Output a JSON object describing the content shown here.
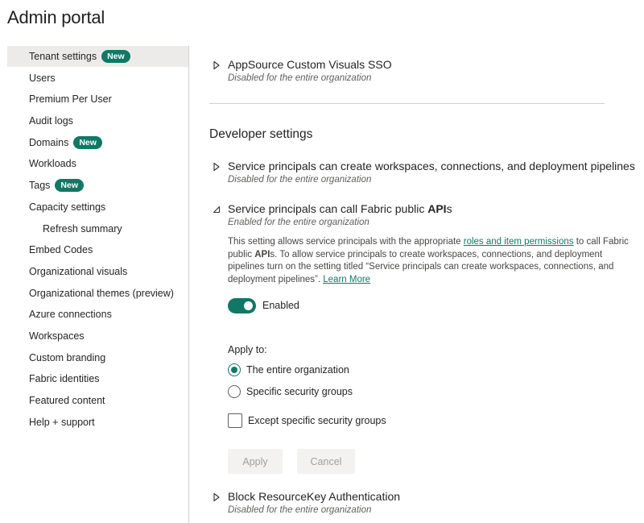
{
  "page": {
    "title": "Admin portal"
  },
  "sidebar": {
    "items": [
      {
        "label": "Tenant settings",
        "badge": "New",
        "active": true
      },
      {
        "label": "Users"
      },
      {
        "label": "Premium Per User"
      },
      {
        "label": "Audit logs"
      },
      {
        "label": "Domains",
        "badge": "New"
      },
      {
        "label": "Workloads"
      },
      {
        "label": "Tags",
        "badge": "New"
      },
      {
        "label": "Capacity settings"
      },
      {
        "label": "Refresh summary",
        "sub": true
      },
      {
        "label": "Embed Codes"
      },
      {
        "label": "Organizational visuals"
      },
      {
        "label": "Organizational themes (preview)"
      },
      {
        "label": "Azure connections"
      },
      {
        "label": "Workspaces"
      },
      {
        "label": "Custom branding"
      },
      {
        "label": "Fabric identities"
      },
      {
        "label": "Featured content"
      },
      {
        "label": "Help + support"
      }
    ]
  },
  "settings": {
    "appsource": {
      "title": "AppSource Custom Visuals SSO",
      "status": "Disabled for the entire organization"
    },
    "developer_heading": "Developer settings",
    "sp_create": {
      "title": "Service principals can create workspaces, connections, and deployment pipelines",
      "status": "Disabled for the entire organization"
    },
    "sp_call": {
      "title_prefix": "Service principals can call Fabric public ",
      "title_bold": "API",
      "title_suffix": "s",
      "status": "Enabled for the entire organization",
      "description": {
        "part1": "This setting allows service principals with the appropriate ",
        "link1": "roles and item permissions",
        "part2": " to call Fabric public ",
        "bold": "API",
        "part3": "s. To allow service principals to create workspaces, connections, and deployment pipelines turn on the setting titled “Service principals can create workspaces, connections, and deployment pipelines”. ",
        "link2": "Learn More"
      },
      "toggle_label": "Enabled",
      "toggle_on": true,
      "apply_to_label": "Apply to:",
      "radio_entire": "The entire organization",
      "radio_specific": "Specific security groups",
      "selected_scope": "The entire organization",
      "except_label": "Except specific security groups",
      "except_checked": false,
      "apply_button": "Apply",
      "cancel_button": "Cancel"
    },
    "resourcekey": {
      "title": "Block ResourceKey Authentication",
      "status": "Disabled for the entire organization"
    }
  },
  "colors": {
    "accent": "#117865",
    "link": "#117865",
    "active_nav_bg": "#edebe9",
    "disabled_button_bg": "#f3f2f1"
  },
  "icons": {
    "collapsed": "chevron-right-icon",
    "expanded": "chevron-expanded-icon"
  }
}
